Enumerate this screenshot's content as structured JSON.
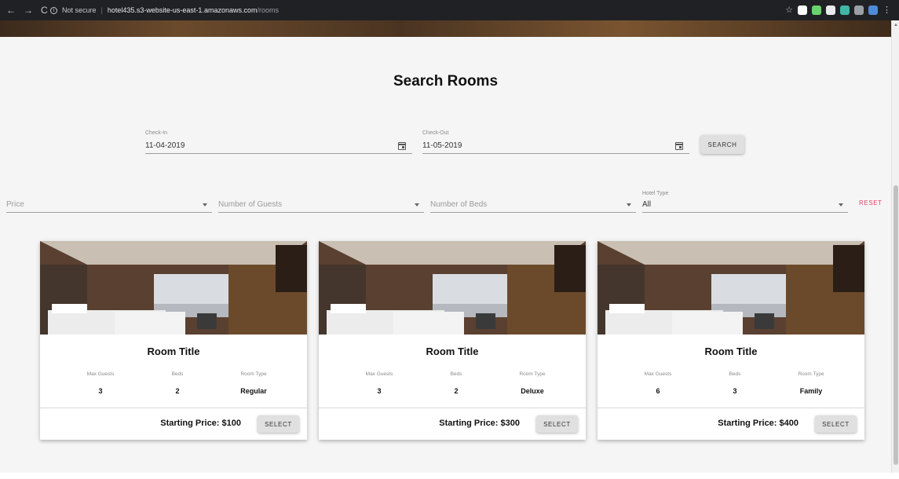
{
  "browser": {
    "security": "Not secure",
    "host": "hotel435.s3-website-us-east-1.amazonaws.com",
    "path": "/rooms",
    "ext_colors": [
      "#ffffff",
      "#6bd36b",
      "#e8eaed",
      "#41b6a6",
      "#9aa0a6",
      "#4f8ad6"
    ]
  },
  "page": {
    "title": "Search Rooms",
    "checkin": {
      "label": "Check-In",
      "value": "11-04-2019"
    },
    "checkout": {
      "label": "Check-Out",
      "value": "11-05-2019"
    },
    "search_label": "SEARCH",
    "filters": {
      "price": "Price",
      "guests": "Number of Guests",
      "beds": "Number of Beds",
      "hotel_type_label": "Hotel Type",
      "hotel_type_value": "All"
    },
    "reset_label": "RESET"
  },
  "rooms": [
    {
      "title": "Room Title",
      "guests_label": "Max Guests",
      "guests": "3",
      "beds_label": "Beds",
      "beds": "2",
      "type_label": "Room Type",
      "type": "Regular",
      "price": "Starting Price: $100",
      "select": "SELECT"
    },
    {
      "title": "Room Title",
      "guests_label": "Max Guests",
      "guests": "3",
      "beds_label": "Beds",
      "beds": "2",
      "type_label": "Room Type",
      "type": "Deluxe",
      "price": "Starting Price: $300",
      "select": "SELECT"
    },
    {
      "title": "Room Title",
      "guests_label": "Max Guests",
      "guests": "6",
      "beds_label": "Beds",
      "beds": "3",
      "type_label": "Room Type",
      "type": "Family",
      "price": "Starting Price: $400",
      "select": "SELECT"
    }
  ],
  "colors": {
    "accent_reset": "#e2456b",
    "background": "#f5f5f5"
  }
}
